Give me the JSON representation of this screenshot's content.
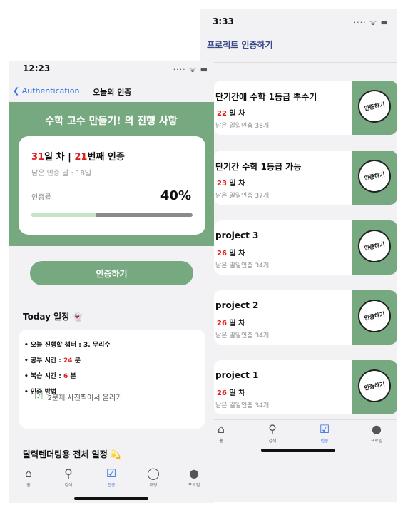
{
  "right_screen": {
    "time": "3:33",
    "sys_icons": "···· ᯤ ▬",
    "title": "프로젝트 인증하기",
    "badge_label": "인증하기",
    "day_suffix": " 일 차",
    "projects": [
      {
        "name": "단기간에 수학 1등급 뿌수기",
        "day": "22",
        "remaining": "남은 일일인증 38개"
      },
      {
        "name": "단기간 수학 1등급 가능",
        "day": "23",
        "remaining": "남은 일일인증 37개"
      },
      {
        "name": "project 3",
        "day": "26",
        "remaining": "남은 일일인증 34개"
      },
      {
        "name": "project 2",
        "day": "26",
        "remaining": "남은 일일인증 34개"
      },
      {
        "name": "project 1",
        "day": "26",
        "remaining": "남은 일일인증 34개"
      }
    ],
    "tabs": [
      {
        "label": "홈",
        "icon": "home-icon",
        "glyph": "⌂"
      },
      {
        "label": "검색",
        "icon": "search-icon",
        "glyph": "⚲"
      },
      {
        "label": "인증",
        "icon": "check-square-icon",
        "glyph": "☑"
      },
      {
        "label": "프로필",
        "icon": "person-icon",
        "glyph": "●"
      }
    ]
  },
  "left_screen": {
    "time": "12:23",
    "sys_icons": "···· ᯤ ▬",
    "back_label": "Authentication",
    "nav_title": "오늘의 인증",
    "hero_title": "수학 고수 만들기! 의 진행 사항",
    "day_count": "31",
    "day_label": "일 차  |  ",
    "cert_count": "21",
    "cert_label": "번째 인증",
    "remaining": "남은 인증 날 : 18일",
    "rate_label": "인증률",
    "rate_percent": "40%",
    "progress_fraction": 0.4,
    "cert_button": "인증하기",
    "today_title": "Today 일정 👻",
    "today_items": {
      "chapter": "• 오늘 진행할 챕터 : 3. 무리수",
      "study_prefix": "• 공부 시간 : ",
      "study_value": "24",
      "study_unit": " 분",
      "review_prefix": "• 복습 시간 : ",
      "review_value": "6",
      "review_unit": " 분",
      "method": "• 인증 방법"
    },
    "method_detail": "2문제 사진찍어서 올리기",
    "total_title": "달력렌더링용 전체 일정 💫",
    "tabs": [
      {
        "label": "홈",
        "icon": "home-icon",
        "glyph": "⌂"
      },
      {
        "label": "검색",
        "icon": "search-icon",
        "glyph": "⚲"
      },
      {
        "label": "인증",
        "icon": "check-square-icon",
        "glyph": "☑"
      },
      {
        "label": "채팅",
        "icon": "chat-icon",
        "glyph": "◯"
      },
      {
        "label": "프로필",
        "icon": "person-icon",
        "glyph": "●"
      }
    ]
  },
  "colors": {
    "accent_green": "#76a97f",
    "highlight_red": "#e01b1b",
    "tab_active_blue": "#3b6ee6",
    "link_blue": "#2f6fe0"
  }
}
